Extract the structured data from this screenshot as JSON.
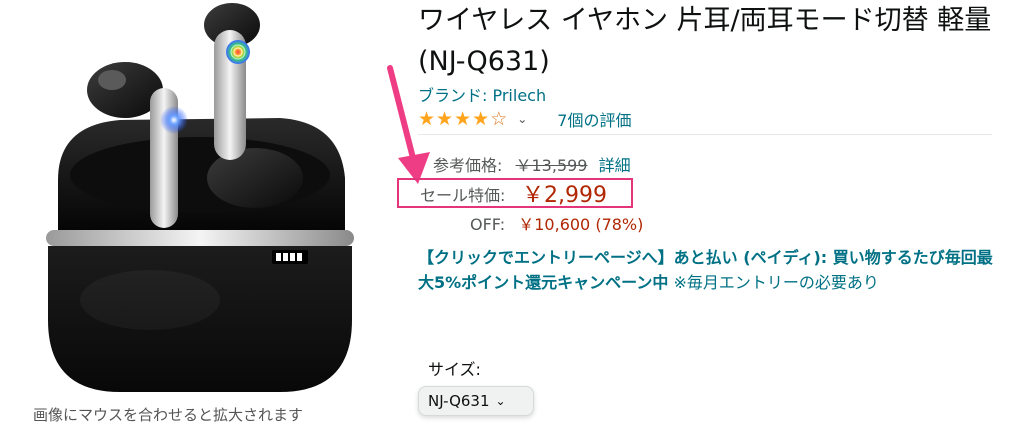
{
  "product": {
    "title": "ワイヤレス イヤホン 片耳/両耳モード切替 軽量 (NJ-Q631)",
    "image_caption": "画像にマウスを合わせると拡大されます"
  },
  "brand": {
    "text": "ブランド: Prilech"
  },
  "rating": {
    "value": 4.5,
    "max": 5,
    "review_count_text": "7個の評価"
  },
  "pricing": {
    "reference_label": "参考価格:",
    "reference_price": "￥13,599",
    "reference_detail": "詳細",
    "sale_label": "セール特価:",
    "sale_price": "￥2,999",
    "off_label": "OFF:",
    "off_value": "￥10,600 (78%)"
  },
  "promo": {
    "link_text": "【クリックでエントリーページへ】あと払い (ペイディ): 買い物するたび毎回最大5%ポイント還元キャンペーン中",
    "note": " ※毎月エントリーの必要あり"
  },
  "size": {
    "label": "サイズ:",
    "selected": "NJ-Q631"
  },
  "colors": {
    "link": "#007185",
    "price": "#b12704",
    "star": "#ffa41c",
    "highlight_box": "#e4347a",
    "arrow": "#ee3d84"
  }
}
